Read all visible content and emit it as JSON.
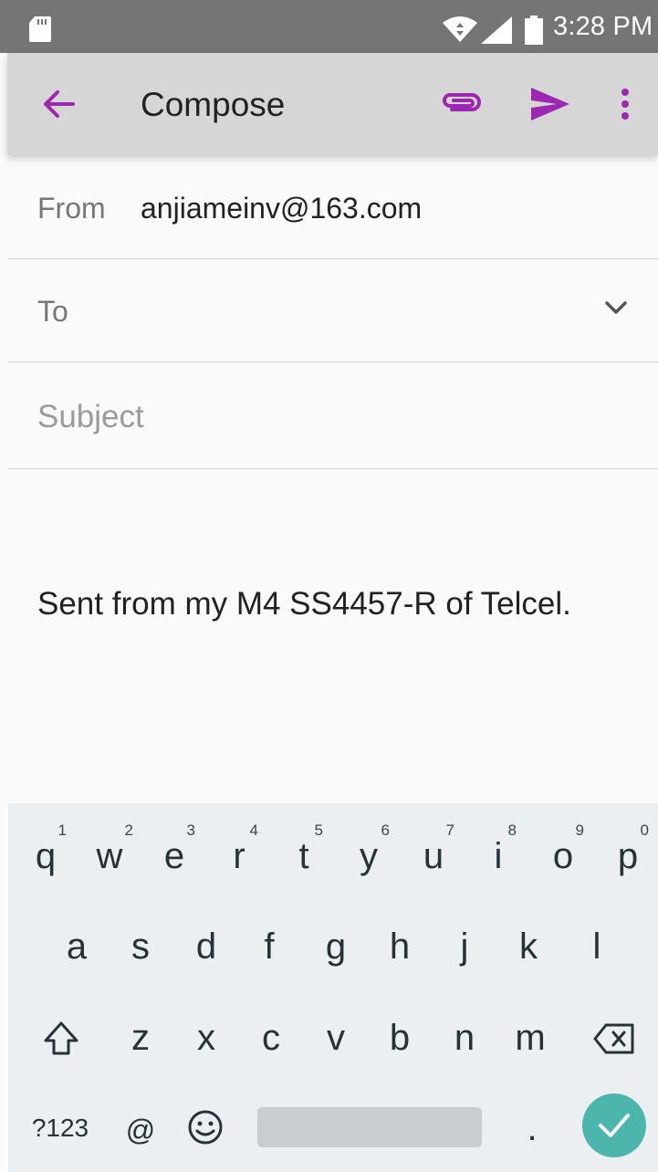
{
  "status_bar": {
    "time": "3:28 PM",
    "icons": [
      "sd-card-icon",
      "wifi-icon",
      "cell-signal-icon",
      "battery-icon"
    ]
  },
  "app_bar": {
    "title": "Compose",
    "icons": [
      "back-arrow-icon",
      "attachment-icon",
      "send-icon",
      "more-vert-icon"
    ],
    "accent_color": "#9c27b0"
  },
  "form": {
    "from_label": "From",
    "from_value": "anjiameinv@163.com",
    "to_label": "To",
    "subject_placeholder": "Subject"
  },
  "body": {
    "signature": "Sent from my M4 SS4457-R of Telcel."
  },
  "keyboard": {
    "row1": [
      {
        "key": "q",
        "hint": "1"
      },
      {
        "key": "w",
        "hint": "2"
      },
      {
        "key": "e",
        "hint": "3"
      },
      {
        "key": "r",
        "hint": "4"
      },
      {
        "key": "t",
        "hint": "5"
      },
      {
        "key": "y",
        "hint": "6"
      },
      {
        "key": "u",
        "hint": "7"
      },
      {
        "key": "i",
        "hint": "8"
      },
      {
        "key": "o",
        "hint": "9"
      },
      {
        "key": "p",
        "hint": "0"
      }
    ],
    "row2": [
      "a",
      "s",
      "d",
      "f",
      "g",
      "h",
      "j",
      "k",
      "l"
    ],
    "row3": [
      "z",
      "x",
      "c",
      "v",
      "b",
      "n",
      "m"
    ],
    "symbols_label": "?123",
    "at_label": "@",
    "period_label": ".",
    "done_color": "#4db6ac"
  }
}
